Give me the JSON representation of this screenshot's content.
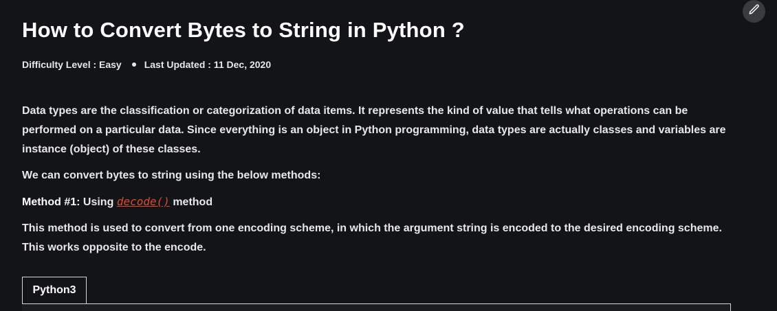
{
  "article": {
    "title": "How to Convert Bytes to String in Python ?",
    "difficulty": "Difficulty Level : Easy",
    "last_updated": "Last Updated : 11 Dec, 2020",
    "paragraphs": [
      "Data types are the classification or categorization of data items. It represents the kind of value that tells what operations can be performed on a particular data. Since everything is an object in Python programming, data types are actually classes and variables are instance (object) of these classes.",
      "We can convert bytes to string using the below methods:"
    ],
    "method": {
      "label": "Method #1:",
      "prefix": "Using",
      "link": "decode()",
      "suffix": "method"
    },
    "method_description": "This method is used to convert from one encoding scheme, in which the argument string is encoded to the desired encoding scheme. This works opposite to the encode."
  },
  "code_tabs": [
    "Python3"
  ],
  "icons": {
    "edit": "pencil-icon"
  },
  "colors": {
    "background": "#131417",
    "link": "#e0492c",
    "text": "#e8e8e8"
  }
}
